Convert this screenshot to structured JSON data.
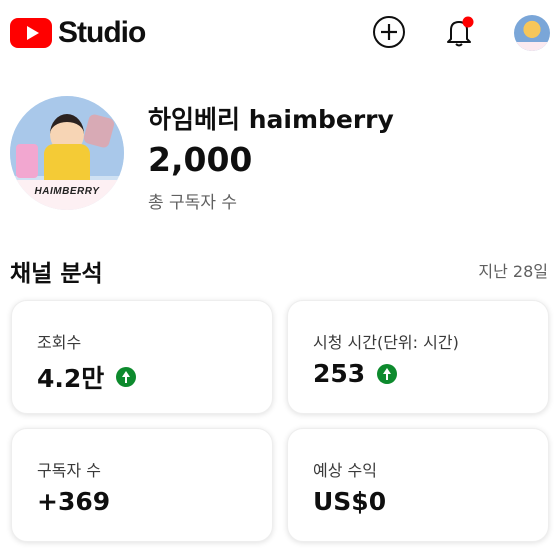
{
  "header": {
    "app_name": "Studio",
    "create_icon": "plus-circle-icon",
    "bell_icon": "bell-notification-icon",
    "notification_dot_color": "#ff0000"
  },
  "profile": {
    "avatar_caption": "HAIMBERRY",
    "channel_name": "하임베리 haimberry",
    "subscriber_count": "2,000",
    "subscriber_label": "총 구독자 수"
  },
  "analytics": {
    "title": "채널 분석",
    "period": "지난 28일",
    "cards": [
      {
        "label": "조회수",
        "value": "4.2만",
        "trend": "up"
      },
      {
        "label": "시청 시간(단위: 시간)",
        "value": "253",
        "trend": "up"
      },
      {
        "label": "구독자 수",
        "value": "+369",
        "trend": ""
      },
      {
        "label": "예상 수익",
        "value": "US$0",
        "trend": ""
      }
    ]
  },
  "colors": {
    "brand_red": "#ff0000",
    "trend_up_green": "#0d8a2d"
  }
}
